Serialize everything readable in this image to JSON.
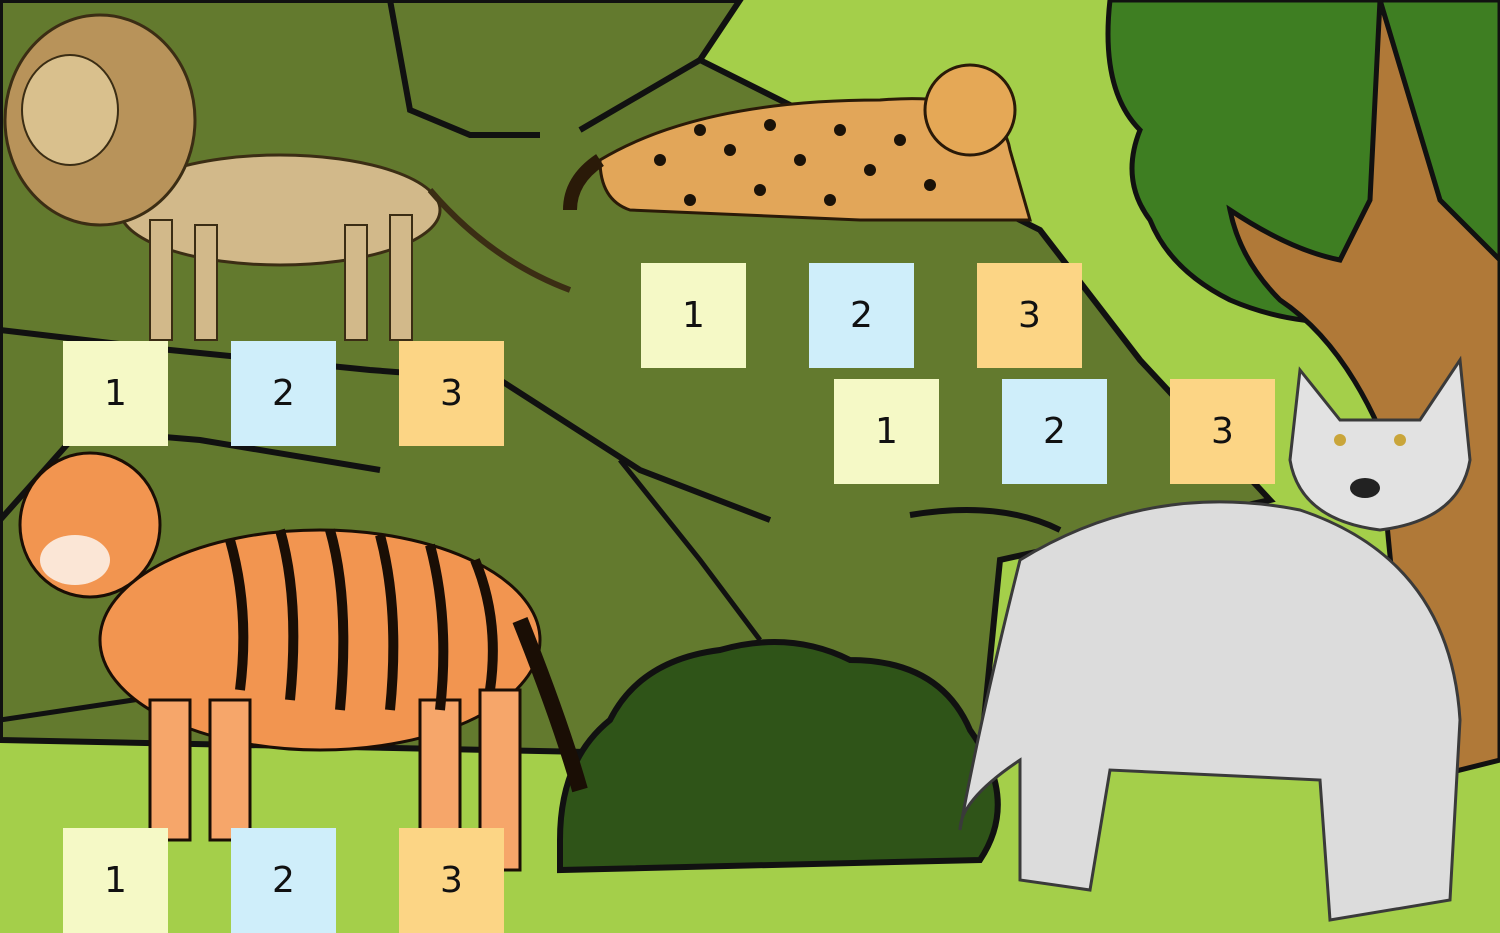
{
  "scene": {
    "description_colors": {
      "sky_grass": "#a4cf4a",
      "rock": "#637a2e",
      "bush": "#2f5418",
      "tree_leaves": "#3e7e22",
      "tree_trunk": "#b07938"
    },
    "tile_colors": {
      "1": "#f5f9c6",
      "2": "#cfeefa",
      "3": "#fcd585"
    }
  },
  "animals": [
    {
      "name": "lion",
      "icon": "lion-icon"
    },
    {
      "name": "jaguar",
      "icon": "jaguar-icon"
    },
    {
      "name": "tiger",
      "icon": "tiger-icon"
    },
    {
      "name": "wolf",
      "icon": "wolf-icon"
    }
  ],
  "tile_groups": {
    "lion": [
      "1",
      "2",
      "3"
    ],
    "jaguar": [
      "1",
      "2",
      "3"
    ],
    "wolf": [
      "1",
      "2",
      "3"
    ],
    "tiger": [
      "1",
      "2",
      "3"
    ]
  }
}
